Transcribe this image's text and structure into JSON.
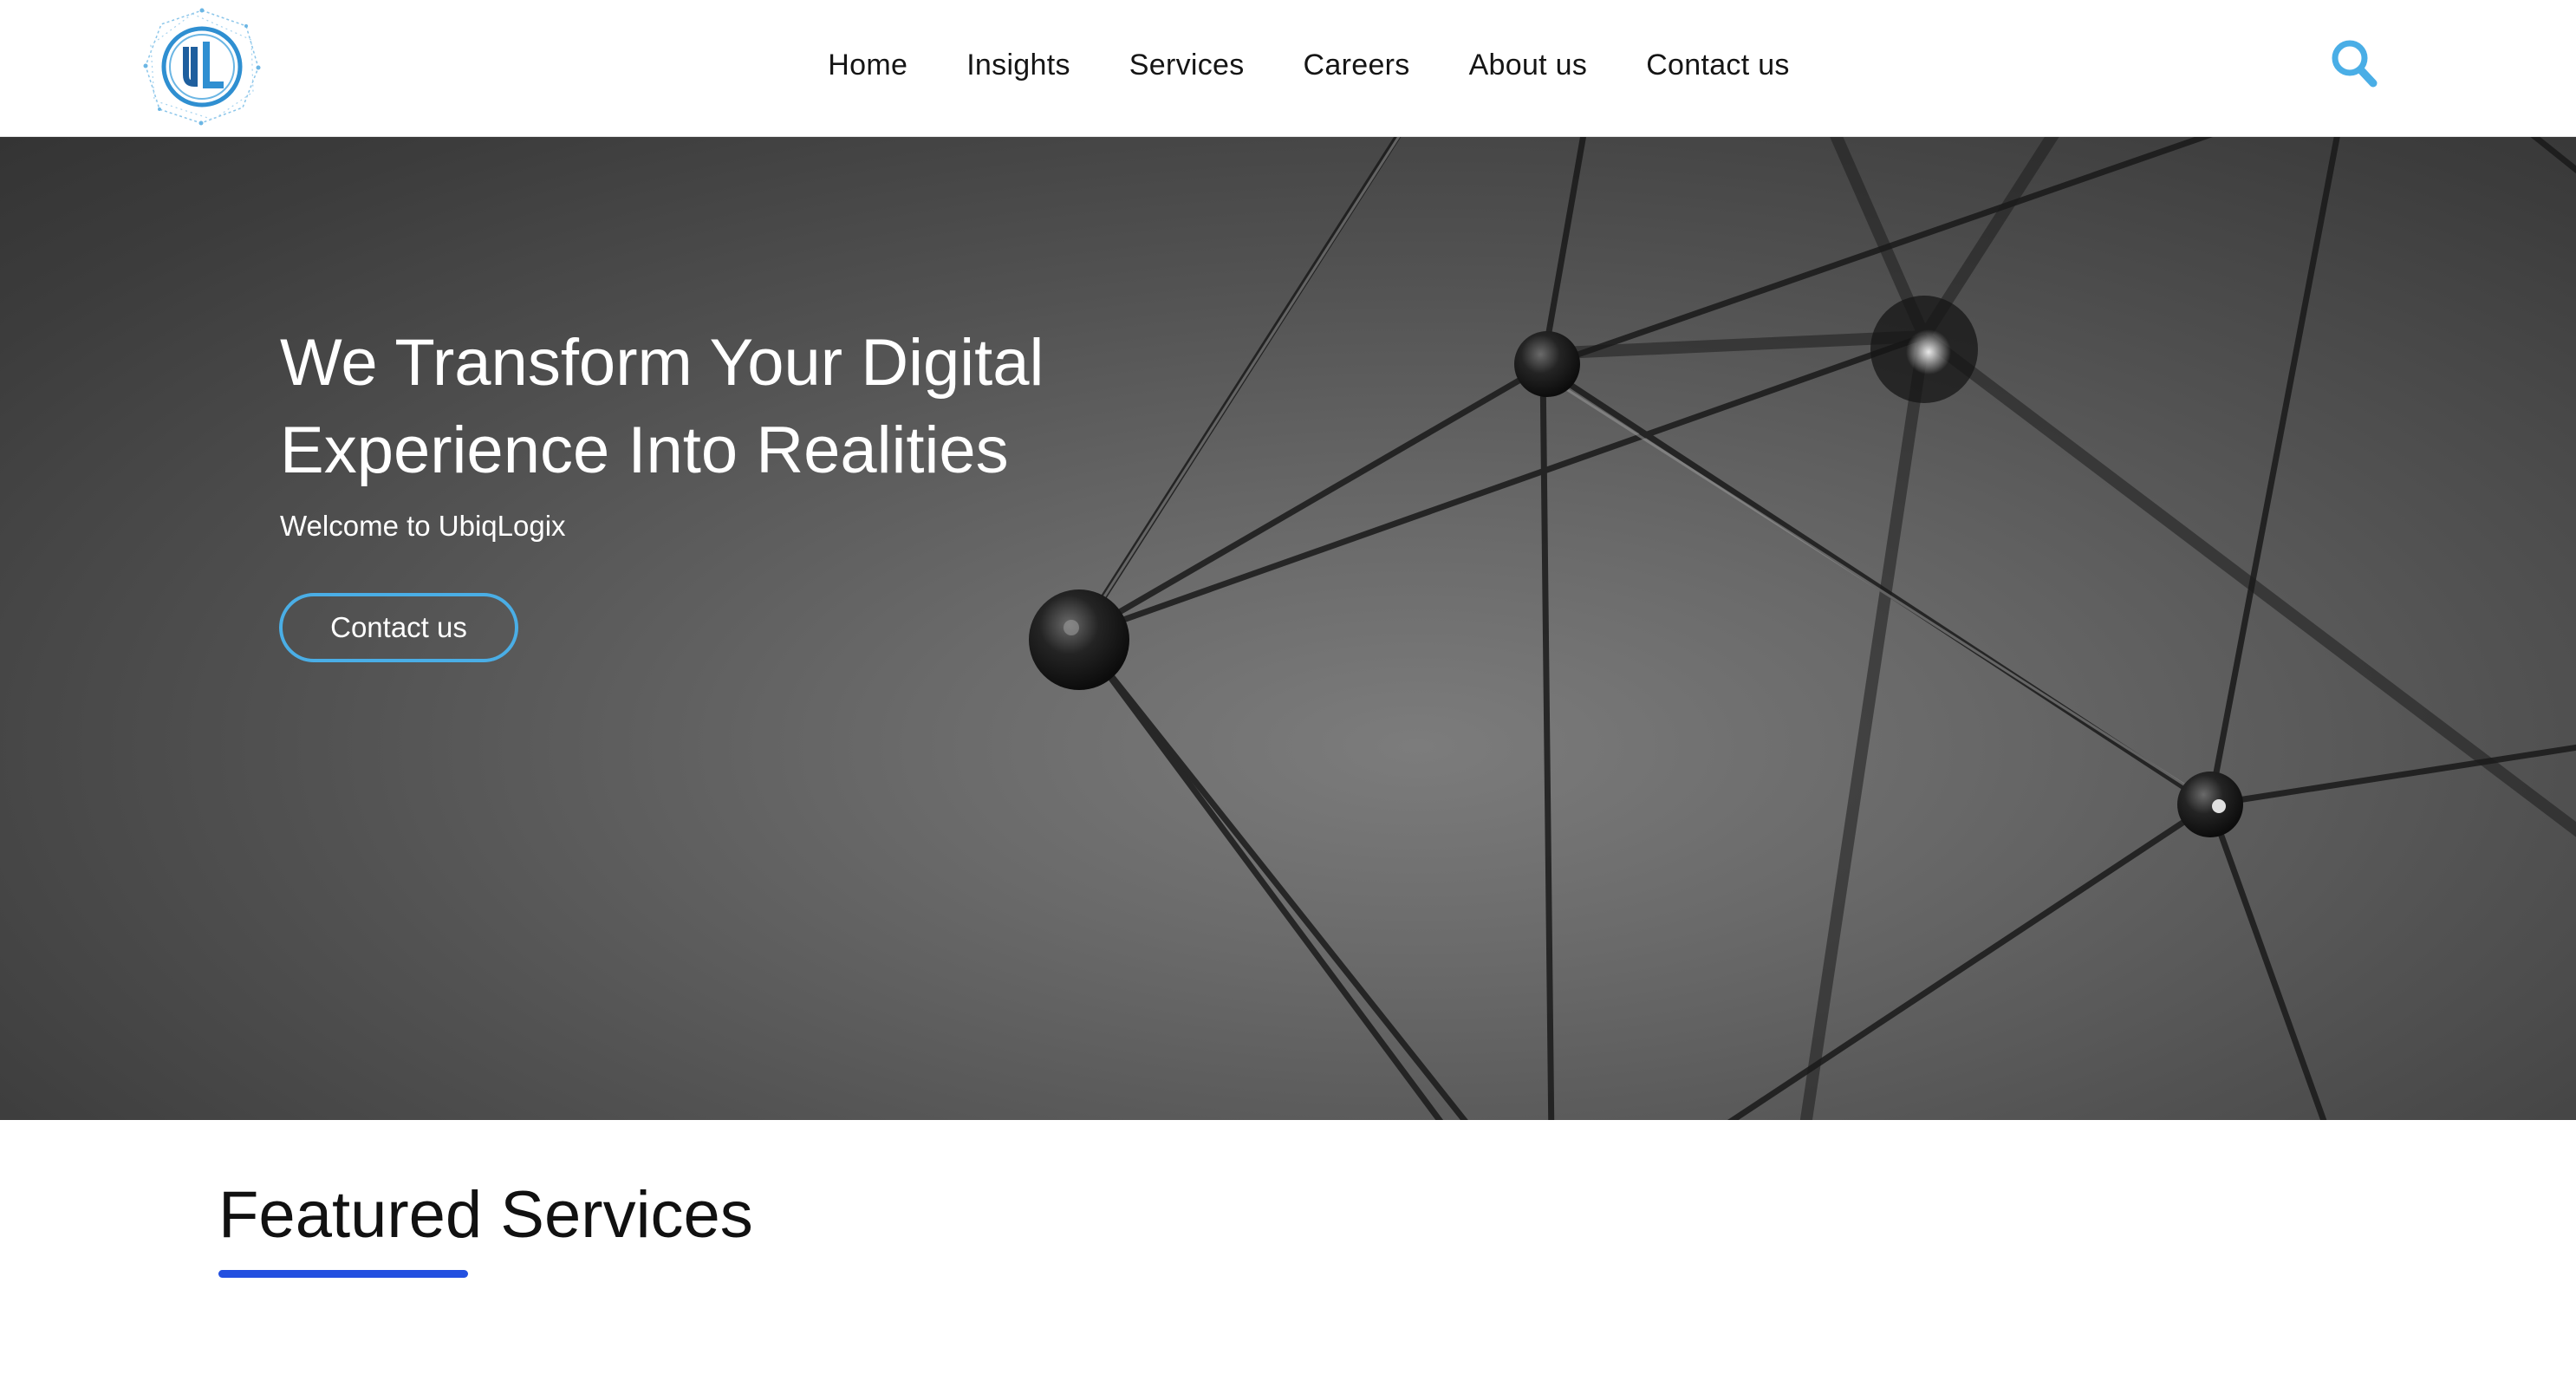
{
  "header": {
    "logo_letters": "UL",
    "nav": [
      {
        "label": "Home"
      },
      {
        "label": "Insights"
      },
      {
        "label": "Services"
      },
      {
        "label": "Careers"
      },
      {
        "label": "About us"
      },
      {
        "label": "Contact us"
      }
    ],
    "search_icon": "search-icon",
    "accent_color": "#4aaee6"
  },
  "hero": {
    "title": "We Transform Your Digital Experience Into Realities",
    "subtitle": "Welcome to UbiqLogix",
    "button_label": "Contact us",
    "button_border_color": "#4aaee6"
  },
  "featured": {
    "title": "Featured Services",
    "underline_color": "#2350e0"
  }
}
